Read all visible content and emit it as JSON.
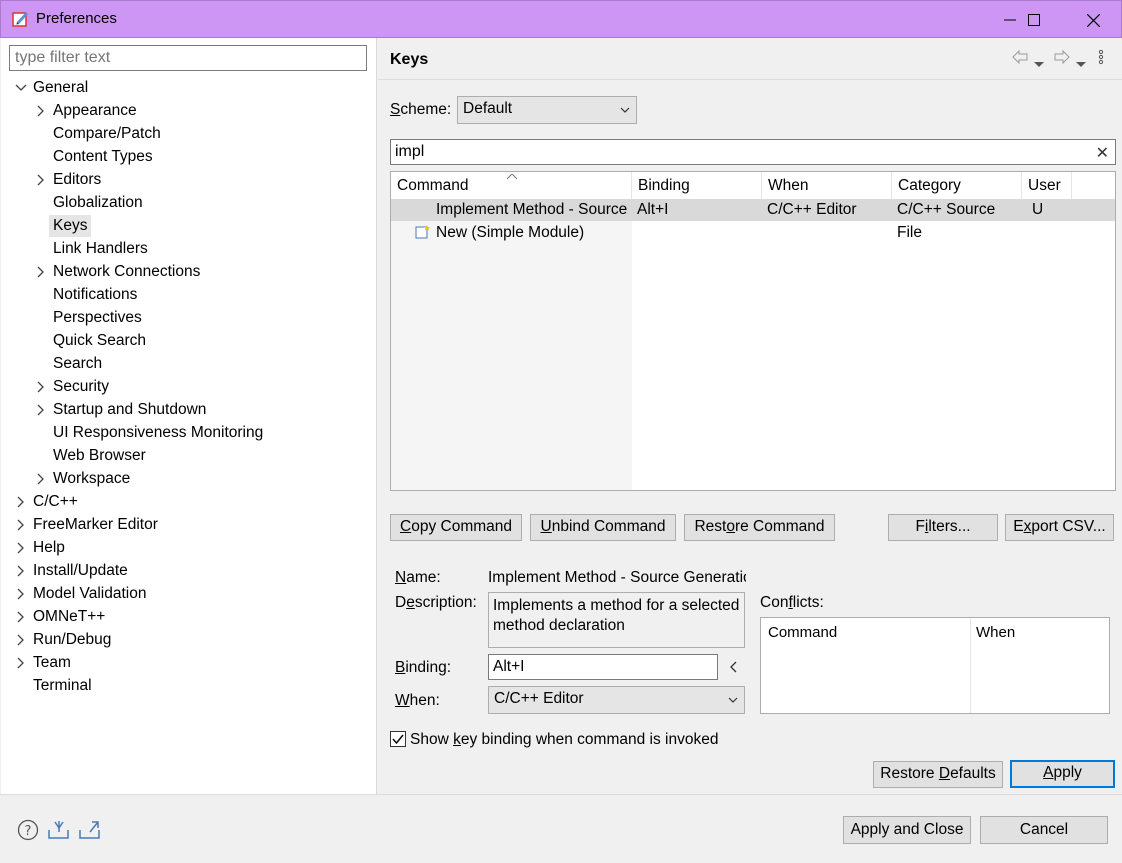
{
  "window": {
    "title": "Preferences",
    "controls": [
      "minimize",
      "maximize",
      "close"
    ]
  },
  "filter": {
    "placeholder": "type filter text"
  },
  "tree": [
    {
      "label": "General",
      "expanded": true,
      "level": 0
    },
    {
      "label": "Appearance",
      "expandable": true,
      "level": 1
    },
    {
      "label": "Compare/Patch",
      "level": 1
    },
    {
      "label": "Content Types",
      "level": 1
    },
    {
      "label": "Editors",
      "expandable": true,
      "level": 1
    },
    {
      "label": "Globalization",
      "level": 1
    },
    {
      "label": "Keys",
      "level": 1,
      "selected": true
    },
    {
      "label": "Link Handlers",
      "level": 1
    },
    {
      "label": "Network Connections",
      "expandable": true,
      "level": 1
    },
    {
      "label": "Notifications",
      "level": 1
    },
    {
      "label": "Perspectives",
      "level": 1
    },
    {
      "label": "Quick Search",
      "level": 1
    },
    {
      "label": "Search",
      "level": 1
    },
    {
      "label": "Security",
      "expandable": true,
      "level": 1
    },
    {
      "label": "Startup and Shutdown",
      "expandable": true,
      "level": 1
    },
    {
      "label": "UI Responsiveness Monitoring",
      "level": 1
    },
    {
      "label": "Web Browser",
      "level": 1
    },
    {
      "label": "Workspace",
      "expandable": true,
      "level": 1
    },
    {
      "label": "C/C++",
      "expandable": true,
      "level": 0
    },
    {
      "label": "FreeMarker Editor",
      "expandable": true,
      "level": 0
    },
    {
      "label": "Help",
      "expandable": true,
      "level": 0
    },
    {
      "label": "Install/Update",
      "expandable": true,
      "level": 0
    },
    {
      "label": "Model Validation",
      "expandable": true,
      "level": 0
    },
    {
      "label": "OMNeT++",
      "expandable": true,
      "level": 0
    },
    {
      "label": "Run/Debug",
      "expandable": true,
      "level": 0
    },
    {
      "label": "Team",
      "expandable": true,
      "level": 0
    },
    {
      "label": "Terminal",
      "level": 0
    }
  ],
  "page": {
    "title": "Keys",
    "scheme_label_u": "S",
    "scheme_label_rest": "cheme:",
    "scheme_value": "Default",
    "search_value": "impl",
    "table": {
      "headers": [
        "Command",
        "Binding",
        "When",
        "Category",
        "User"
      ],
      "rows": [
        {
          "command": "Implement Method - Source Generation",
          "binding": "Alt+I",
          "when": "C/C++ Editor",
          "category": "C/C++ Source",
          "user": "U",
          "selected": true
        },
        {
          "command": "New (Simple Module)",
          "binding": "",
          "when": "",
          "category": "File",
          "user": ""
        }
      ]
    },
    "buttons": {
      "copy_u": "C",
      "copy_rest": "opy Command",
      "unbind_u": "U",
      "unbind_rest": "nbind Command",
      "restore_a": "Rest",
      "restore_u": "o",
      "restore_b": "re Command",
      "filters_a": "F",
      "filters_u": "i",
      "filters_b": "lters...",
      "export_a": "E",
      "export_u": "x",
      "export_b": "port CSV..."
    },
    "details": {
      "name_u": "N",
      "name_rest": "ame:",
      "name_value": "Implement Method - Source Generation",
      "desc_a": "D",
      "desc_u": "e",
      "desc_b": "scription:",
      "description": "Implements a method for a selected method declaration",
      "binding_u": "B",
      "binding_rest": "inding:",
      "binding_value": "Alt+I",
      "when_u": "W",
      "when_rest": "hen:",
      "when_value": "C/C++ Editor",
      "conflicts_a": "Con",
      "conflicts_u": "f",
      "conflicts_b": "licts:",
      "conflicts_headers": [
        "Command",
        "When"
      ]
    },
    "show_binding": {
      "a": "Show ",
      "u": "k",
      "b": "ey binding when command is invoked",
      "checked": true
    },
    "restore_defaults_a": "Restore ",
    "restore_defaults_u": "D",
    "restore_defaults_b": "efaults",
    "apply_u": "A",
    "apply_rest": "pply"
  },
  "footer": {
    "apply_close": "Apply and Close",
    "cancel": "Cancel"
  },
  "colors": {
    "titlebar": "#cd96f5",
    "selection": "#d9d9d9",
    "default_button_border": "#0078d7"
  }
}
